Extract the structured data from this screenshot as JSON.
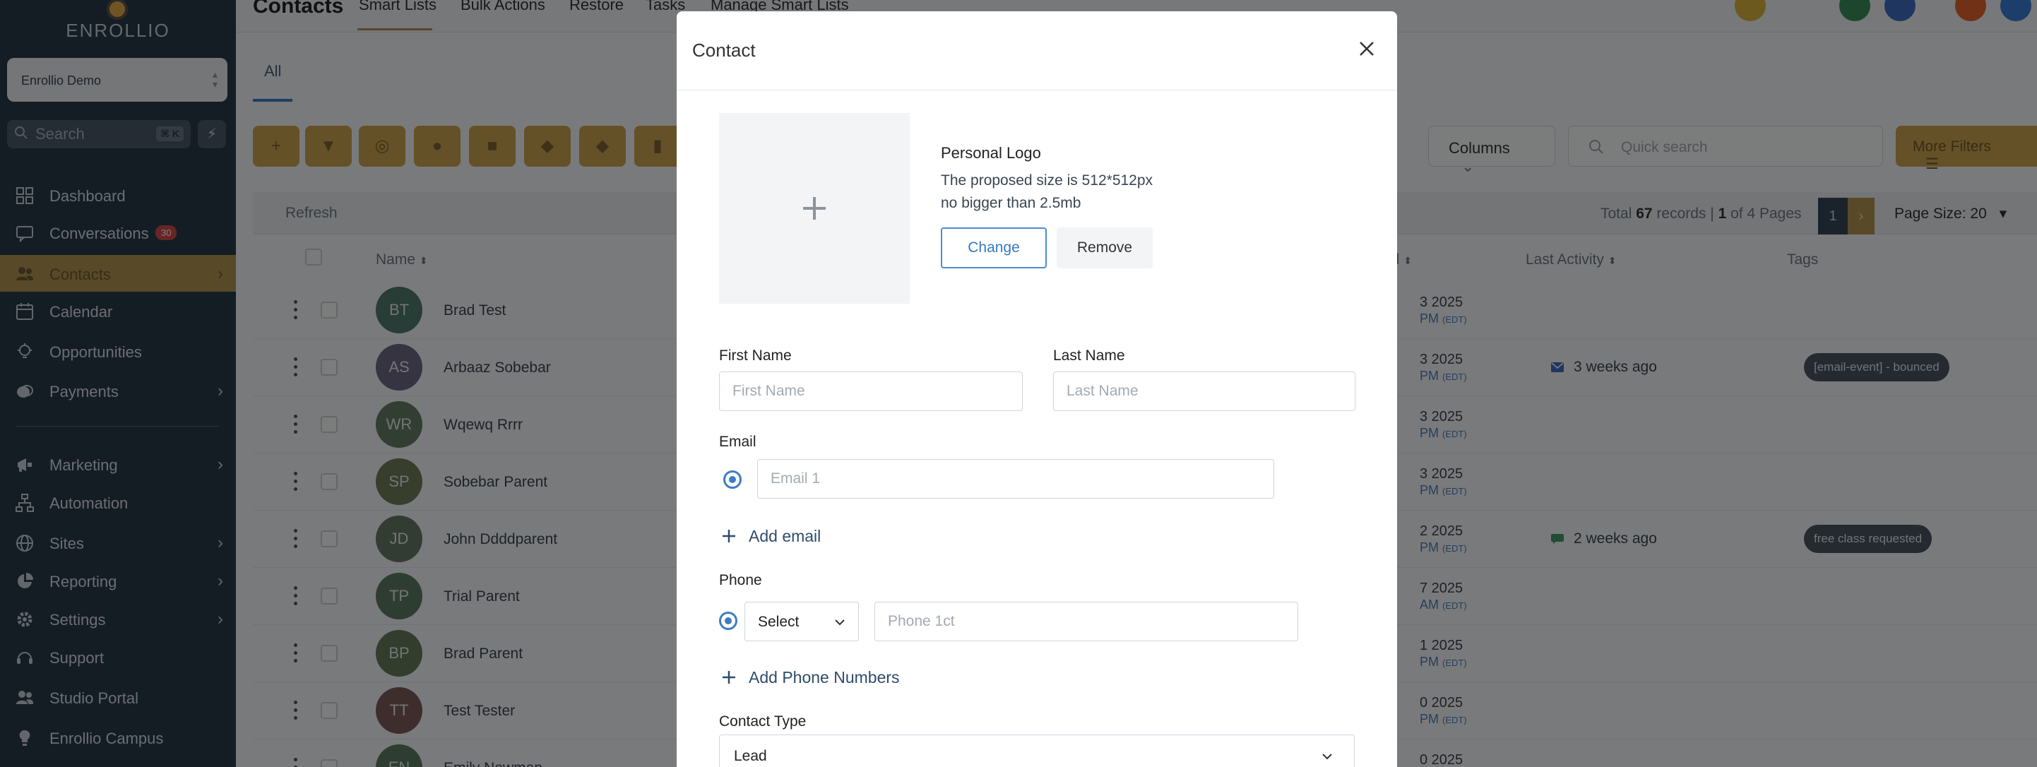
{
  "sidebar": {
    "logo_text": "ENROLLIO",
    "account": "Enrollio Demo",
    "search_placeholder": "Search",
    "search_shortcut": "⌘ K",
    "items": [
      {
        "label": "Dashboard",
        "icon": "grid-icon"
      },
      {
        "label": "Conversations",
        "icon": "chat-icon",
        "badge": "30"
      },
      {
        "label": "Contacts",
        "icon": "users-icon",
        "active": true
      },
      {
        "label": "Calendar",
        "icon": "calendar-icon"
      },
      {
        "label": "Opportunities",
        "icon": "bulb-icon"
      },
      {
        "label": "Payments",
        "icon": "coins-icon"
      },
      {
        "label": "Marketing",
        "icon": "megaphone-icon"
      },
      {
        "label": "Automation",
        "icon": "flow-icon"
      },
      {
        "label": "Sites",
        "icon": "globe-icon"
      },
      {
        "label": "Reporting",
        "icon": "pie-icon"
      },
      {
        "label": "Settings",
        "icon": "gear-icon"
      },
      {
        "label": "Support",
        "icon": "headset-icon"
      },
      {
        "label": "Studio Portal",
        "icon": "users-icon"
      },
      {
        "label": "Enrollio Campus",
        "icon": "bulb-icon"
      }
    ]
  },
  "topbar": {
    "title": "Contacts",
    "tabs": [
      "Smart Lists",
      "Bulk Actions",
      "Restore",
      "Tasks",
      "Manage Smart Lists"
    ]
  },
  "subtab": "All",
  "toolbar": {
    "columns_label": "Columns",
    "quick_search_placeholder": "Quick search",
    "more_filters_label": "More Filters"
  },
  "table": {
    "refresh_label": "Refresh",
    "records_prefix": "Total",
    "records_total": "67",
    "records_mid": "records |",
    "records_page": "1",
    "records_suffix": "of 4 Pages",
    "current_page": "1",
    "page_size_label": "Page Size: 20",
    "columns": [
      "Name",
      "ed",
      "Last Activity",
      "Tags"
    ],
    "rows": [
      {
        "initials": "BT",
        "name": "Brad Test",
        "date": "3 2025",
        "time": "PM",
        "tz": "(EDT)",
        "activity": "",
        "tag": "",
        "color": "#4f7a6c"
      },
      {
        "initials": "AS",
        "name": "Arbaaz Sobebar",
        "date": "3 2025",
        "time": "PM",
        "tz": "(EDT)",
        "activity": "3 weeks ago",
        "activity_icon": "mail",
        "tag": "[email-event] - bounced",
        "color": "#6c6883"
      },
      {
        "initials": "WR",
        "name": "Wqewq Rrrr",
        "date": "3 2025",
        "time": "PM",
        "tz": "(EDT)",
        "activity": "",
        "tag": "",
        "color": "#647c63"
      },
      {
        "initials": "SP",
        "name": "Sobebar Parent",
        "date": "3 2025",
        "time": "PM",
        "tz": "(EDT)",
        "activity": "",
        "tag": "",
        "color": "#6f7d58"
      },
      {
        "initials": "JD",
        "name": "John Ddddparent",
        "date": "2 2025",
        "time": "PM",
        "tz": "(EDT)",
        "activity": "2 weeks ago",
        "activity_icon": "chat",
        "tag": "free class requested",
        "color": "#667866"
      },
      {
        "initials": "TP",
        "name": "Trial Parent",
        "date": "7 2025",
        "time": "AM",
        "tz": "(EDT)",
        "activity": "",
        "tag": "",
        "color": "#5c7a65"
      },
      {
        "initials": "BP",
        "name": "Brad Parent",
        "date": "1 2025",
        "time": "PM",
        "tz": "(EDT)",
        "activity": "",
        "tag": "",
        "color": "#657a5b"
      },
      {
        "initials": "TT",
        "name": "Test Tester",
        "date": "0 2025",
        "time": "PM",
        "tz": "(EDT)",
        "activity": "",
        "tag": "",
        "color": "#7c5a5a"
      },
      {
        "initials": "EN",
        "name": "Emily Newman",
        "date": "0 2025",
        "time": "",
        "tz": "",
        "activity": "",
        "tag": "",
        "color": "#5b7a62"
      }
    ]
  },
  "modal": {
    "title": "Contact",
    "logo": {
      "title": "Personal Logo",
      "size_text": "The proposed size is 512*512px",
      "limit_text": "no bigger than 2.5mb",
      "change_label": "Change",
      "remove_label": "Remove"
    },
    "first_name": {
      "label": "First Name",
      "placeholder": "First Name",
      "value": ""
    },
    "last_name": {
      "label": "Last Name",
      "placeholder": "Last Name",
      "value": ""
    },
    "email": {
      "label": "Email",
      "placeholder": "Email 1",
      "add_label": "Add email"
    },
    "phone": {
      "label": "Phone",
      "select_value": "Select",
      "placeholder": "Phone 1ct",
      "add_label": "Add Phone Numbers"
    },
    "contact_type": {
      "label": "Contact Type",
      "value": "Lead"
    }
  },
  "colors": {
    "sidebar_bg": "#2b3a49",
    "accent_gold": "#b19353",
    "primary_blue": "#3e7cc3"
  }
}
